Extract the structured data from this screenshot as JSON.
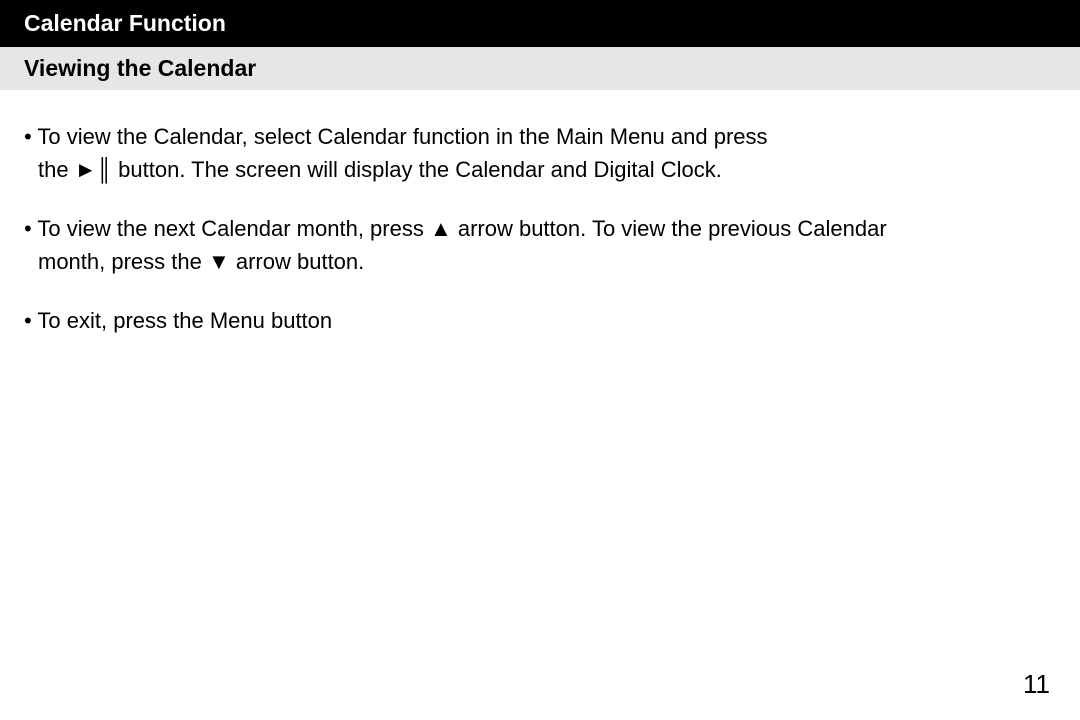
{
  "header": {
    "title": "Calendar Function"
  },
  "subheader": {
    "title": "Viewing the Calendar"
  },
  "bullets": {
    "b1_line1": "• To view the Calendar, select Calendar function in the Main Menu and press",
    "b1_line2": "the ►║ button.  The screen will display the Calendar and Digital Clock.",
    "b2_line1": "• To view the next Calendar month, press ▲ arrow button.  To view the previous Calendar",
    "b2_line2": "month, press the ▼ arrow button.",
    "b3_line1": "• To exit, press the Menu button"
  },
  "page_number": "11"
}
